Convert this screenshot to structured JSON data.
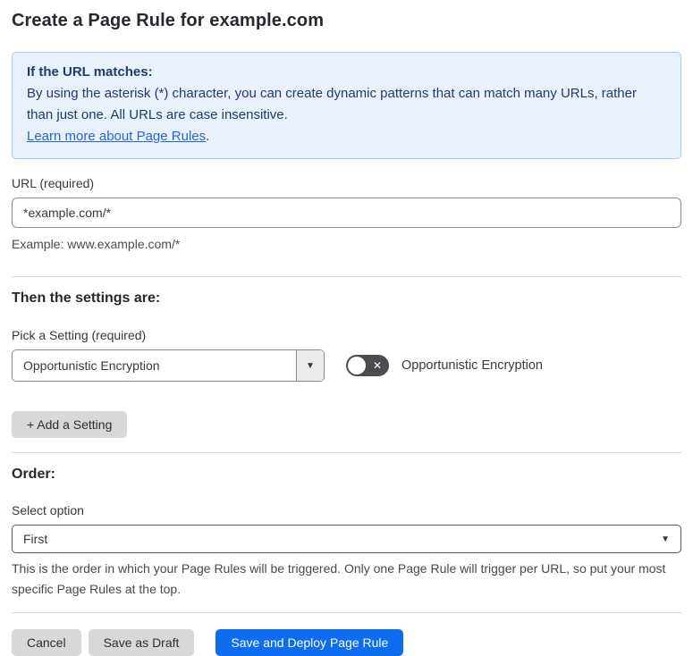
{
  "page": {
    "title": "Create a Page Rule for example.com"
  },
  "info_box": {
    "heading": "If the URL matches:",
    "body": "By using the asterisk (*) character, you can create dynamic patterns that can match many URLs, rather than just one. All URLs are case insensitive.",
    "link_label": "Learn more about Page Rules",
    "link_suffix": "."
  },
  "url_field": {
    "label": "URL (required)",
    "value": "*example.com/*",
    "helper": "Example: www.example.com/*"
  },
  "settings_section": {
    "heading": "Then the settings are:",
    "pick_label": "Pick a Setting (required)",
    "selected_setting": "Opportunistic Encryption",
    "toggle_label": "Opportunistic Encryption",
    "toggle_state": "off",
    "add_button_label": "+ Add a Setting"
  },
  "order_section": {
    "heading": "Order:",
    "select_label": "Select option",
    "selected_option": "First",
    "helper": "This is the order in which your Page Rules will be triggered. Only one Page Rule will trigger per URL, so put your most specific Page Rules at the top."
  },
  "footer": {
    "cancel_label": "Cancel",
    "save_draft_label": "Save as Draft",
    "save_deploy_label": "Save and Deploy Page Rule"
  },
  "icons": {
    "dropdown_arrow": "▼",
    "toggle_x": "✕"
  },
  "colors": {
    "info_bg": "#e9f2fc",
    "info_border": "#a9c9ee",
    "info_text": "#1e3b6e",
    "link_blue": "#2962d9",
    "primary_button_blue": "#0d6cf0",
    "toggle_off_gray": "#4a4c50",
    "secondary_button_gray": "#d8d8d8"
  }
}
